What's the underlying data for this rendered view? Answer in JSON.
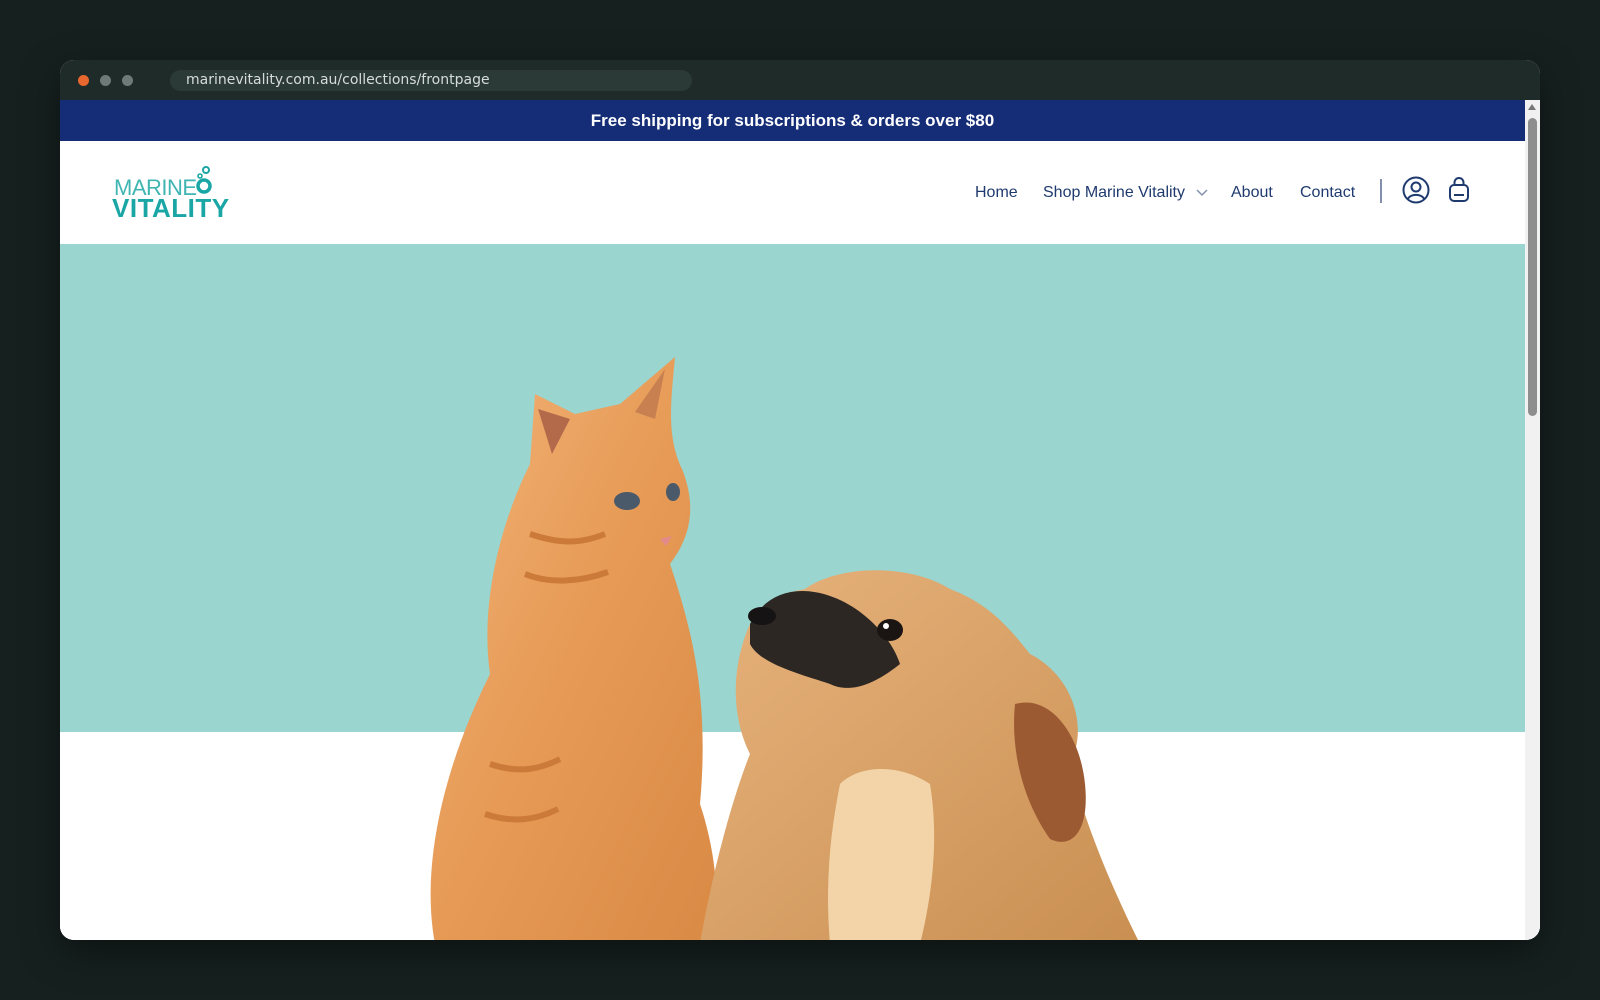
{
  "browser": {
    "url": "marinevitality.com.au/collections/frontpage",
    "traffic_lights": [
      "close",
      "minimize",
      "maximize"
    ]
  },
  "announcement": {
    "text": "Free shipping for subscriptions & orders over $80",
    "background": "#152c76"
  },
  "header": {
    "logo": {
      "line1": "MARINE",
      "line2": "VITALITY",
      "color": "#1ba6a6"
    },
    "nav": [
      {
        "label": "Home"
      },
      {
        "label": "Shop Marine Vitality",
        "has_dropdown": true
      },
      {
        "label": "About"
      },
      {
        "label": "Contact"
      }
    ],
    "icons": [
      "account-icon",
      "cart-bag-icon"
    ]
  },
  "hero": {
    "background": "#9ad5cf",
    "image": "orange-kitten-and-puppy"
  }
}
